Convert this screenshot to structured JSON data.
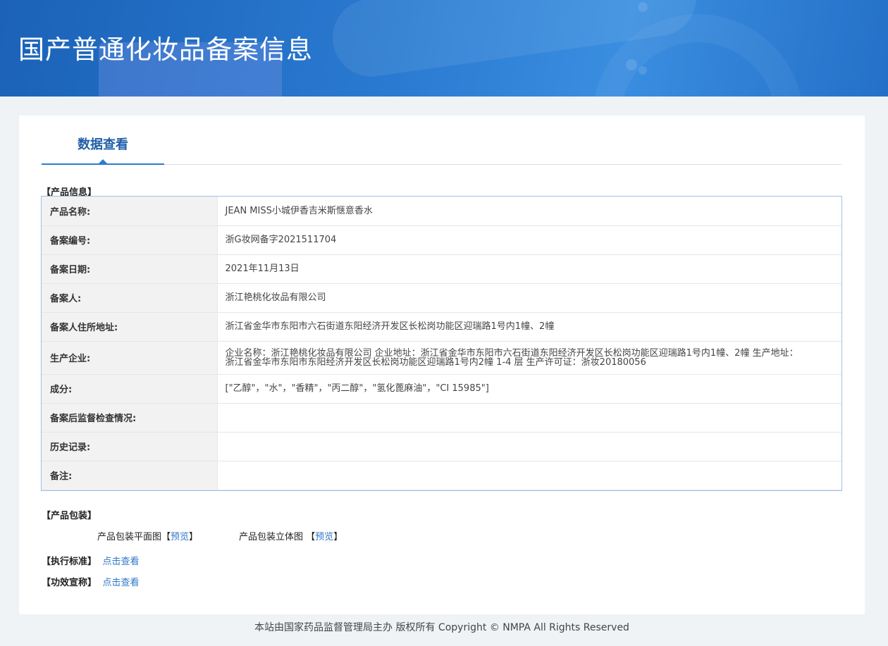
{
  "header": {
    "title": "国产普通化妆品备案信息"
  },
  "tabs": [
    {
      "label": "数据查看"
    }
  ],
  "product_info": {
    "section_title": "【产品信息】",
    "rows": [
      {
        "label": "产品名称:",
        "value": "JEAN MISS小城伊香吉米斯惬意香水"
      },
      {
        "label": "备案编号:",
        "value": "浙G妆网备字2021511704"
      },
      {
        "label": "备案日期:",
        "value": "2021年11月13日"
      },
      {
        "label": "备案人:",
        "value": "浙江艳桃化妆品有限公司"
      },
      {
        "label": "备案人住所地址:",
        "value": "浙江省金华市东阳市六石街道东阳经济开发区长松岗功能区迎瑞路1号内1幢、2幢"
      },
      {
        "label": "生产企业:",
        "value_line1": "企业名称：浙江艳桃化妆品有限公司 企业地址：浙江省金华市东阳市六石街道东阳经济开发区长松岗功能区迎瑞路1号内1幢、2幢 生产地址：",
        "value_line2": "浙江省金华市东阳市东阳经济开发区长松岗功能区迎瑞路1号内2幢 1-4 层 生产许可证：浙妆20180056"
      },
      {
        "label": "成分:",
        "value": "[\"乙醇\"，\"水\"，\"香精\"，\"丙二醇\"，\"氢化蓖麻油\"，\"CI 15985\"]"
      },
      {
        "label": "备案后监督检查情况:",
        "value": ""
      },
      {
        "label": "历史记录:",
        "value": ""
      },
      {
        "label": "备注:",
        "value": ""
      }
    ]
  },
  "packaging": {
    "section_title": "【产品包装】",
    "flat_label": "产品包装平面图",
    "flat_bracket_open": "【",
    "flat_link": "预览",
    "flat_bracket_close": "】",
    "solid_label": "产品包装立体图",
    "solid_bracket_open": "【",
    "solid_link": "预览",
    "solid_bracket_close": "】"
  },
  "standard": {
    "label": "【执行标准】",
    "link": "点击查看"
  },
  "efficacy": {
    "label": "【功效宣称】",
    "link": "点击查看"
  },
  "footer": {
    "text": "本站由国家药品监督管理局主办 版权所有 Copyright © NMPA All Rights Reserved"
  }
}
